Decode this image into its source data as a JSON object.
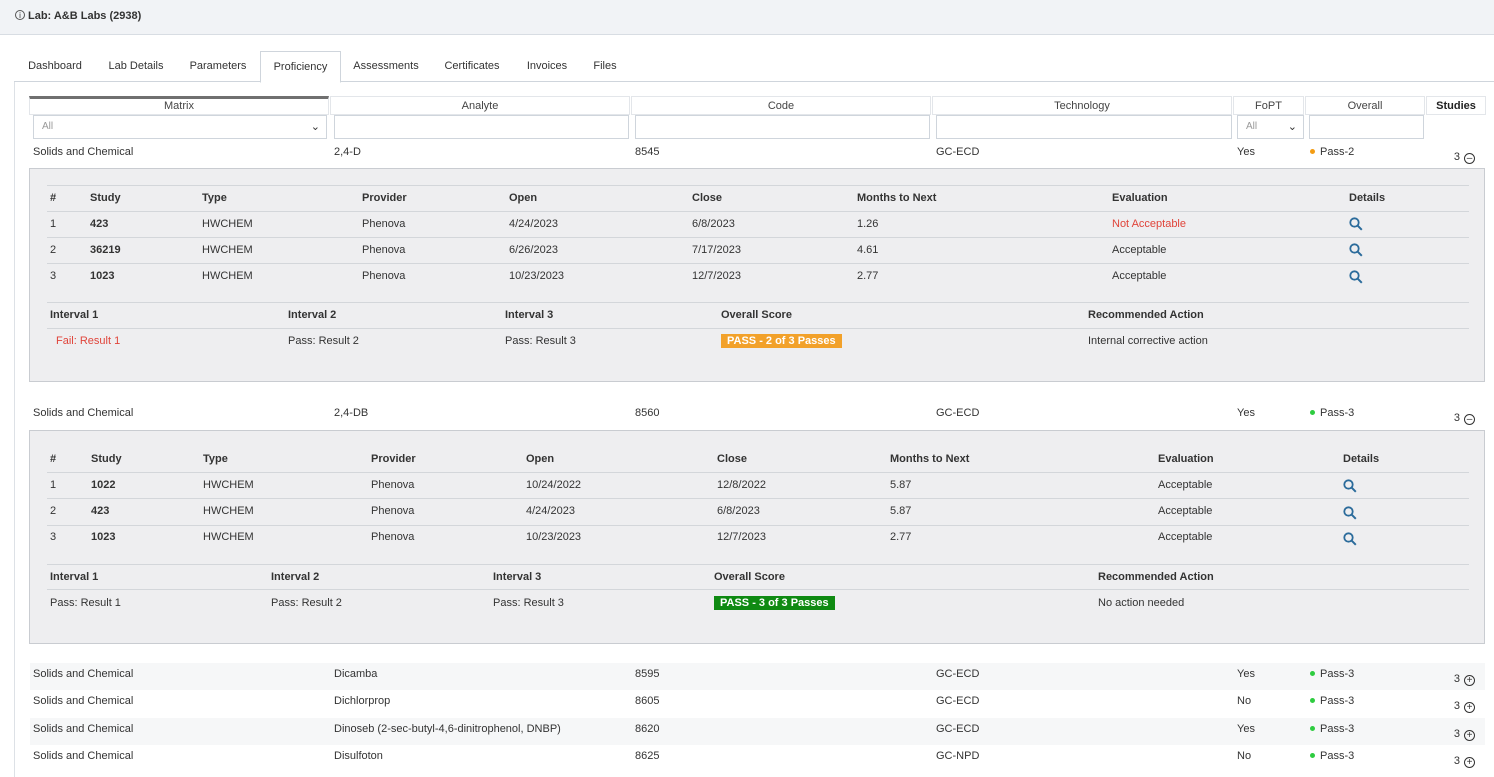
{
  "header": {
    "title": "Lab: A&B Labs (2938)"
  },
  "tabs": [
    "Dashboard",
    "Lab Details",
    "Parameters",
    "Proficiency",
    "Assessments",
    "Certificates",
    "Invoices",
    "Files"
  ],
  "columns": {
    "matrix": "Matrix",
    "analyte": "Analyte",
    "code": "Code",
    "technology": "Technology",
    "fopt": "FoPT",
    "overall": "Overall",
    "studies": "Studies"
  },
  "filters": {
    "matrix": "All",
    "fopt": "All"
  },
  "colors": {
    "orange_dot": "#f39c12",
    "green_dot": "#2ecc40",
    "fail": "#e0443a",
    "pass_partial": "#f2a12a",
    "pass_full": "#0f8a12"
  },
  "rows": [
    {
      "matrix": "Solids and Chemical",
      "analyte": "2,4-D",
      "code": "8545",
      "technology": "GC-ECD",
      "fopt": "Yes",
      "overall": "Pass-2",
      "studies": "3",
      "details": {
        "headers": [
          "#",
          "Study",
          "Type",
          "Provider",
          "Open",
          "Close",
          "Months to Next",
          "Evaluation",
          "Details"
        ],
        "studies": [
          {
            "n": "1",
            "study": "423",
            "type": "HWCHEM",
            "provider": "Phenova",
            "open": "4/24/2023",
            "close": "6/8/2023",
            "months": "1.26",
            "evaluation": "Not Acceptable"
          },
          {
            "n": "2",
            "study": "36219",
            "type": "HWCHEM",
            "provider": "Phenova",
            "open": "6/26/2023",
            "close": "7/17/2023",
            "months": "4.61",
            "evaluation": "Acceptable"
          },
          {
            "n": "3",
            "study": "1023",
            "type": "HWCHEM",
            "provider": "Phenova",
            "open": "10/23/2023",
            "close": "12/7/2023",
            "months": "2.77",
            "evaluation": "Acceptable"
          }
        ],
        "summary_headers": [
          "Interval 1",
          "Interval 2",
          "Interval 3",
          "Overall Score",
          "Recommended Action"
        ],
        "summary": {
          "i1": "Fail: Result 1",
          "i2": "Pass: Result 2",
          "i3": "Pass: Result 3",
          "score": "PASS - 2 of 3 Passes",
          "action": "Internal corrective action"
        }
      }
    },
    {
      "matrix": "Solids and Chemical",
      "analyte": "2,4-DB",
      "code": "8560",
      "technology": "GC-ECD",
      "fopt": "Yes",
      "overall": "Pass-3",
      "studies": "3",
      "details": {
        "headers": [
          "#",
          "Study",
          "Type",
          "Provider",
          "Open",
          "Close",
          "Months to Next",
          "Evaluation",
          "Details"
        ],
        "studies": [
          {
            "n": "1",
            "study": "1022",
            "type": "HWCHEM",
            "provider": "Phenova",
            "open": "10/24/2022",
            "close": "12/8/2022",
            "months": "5.87",
            "evaluation": "Acceptable"
          },
          {
            "n": "2",
            "study": "423",
            "type": "HWCHEM",
            "provider": "Phenova",
            "open": "4/24/2023",
            "close": "6/8/2023",
            "months": "5.87",
            "evaluation": "Acceptable"
          },
          {
            "n": "3",
            "study": "1023",
            "type": "HWCHEM",
            "provider": "Phenova",
            "open": "10/23/2023",
            "close": "12/7/2023",
            "months": "2.77",
            "evaluation": "Acceptable"
          }
        ],
        "summary_headers": [
          "Interval 1",
          "Interval 2",
          "Interval 3",
          "Overall Score",
          "Recommended Action"
        ],
        "summary": {
          "i1": "Pass: Result 1",
          "i2": "Pass: Result 2",
          "i3": "Pass: Result 3",
          "score": "PASS - 3 of 3 Passes",
          "action": "No action needed"
        }
      }
    },
    {
      "matrix": "Solids and Chemical",
      "analyte": "Dicamba",
      "code": "8595",
      "technology": "GC-ECD",
      "fopt": "Yes",
      "overall": "Pass-3",
      "studies": "3"
    },
    {
      "matrix": "Solids and Chemical",
      "analyte": "Dichlorprop",
      "code": "8605",
      "technology": "GC-ECD",
      "fopt": "No",
      "overall": "Pass-3",
      "studies": "3"
    },
    {
      "matrix": "Solids and Chemical",
      "analyte": "Dinoseb (2-sec-butyl-4,6-dinitrophenol, DNBP)",
      "code": "8620",
      "technology": "GC-ECD",
      "fopt": "Yes",
      "overall": "Pass-3",
      "studies": "3"
    },
    {
      "matrix": "Solids and Chemical",
      "analyte": "Disulfoton",
      "code": "8625",
      "technology": "GC-NPD",
      "fopt": "No",
      "overall": "Pass-3",
      "studies": "3"
    }
  ]
}
